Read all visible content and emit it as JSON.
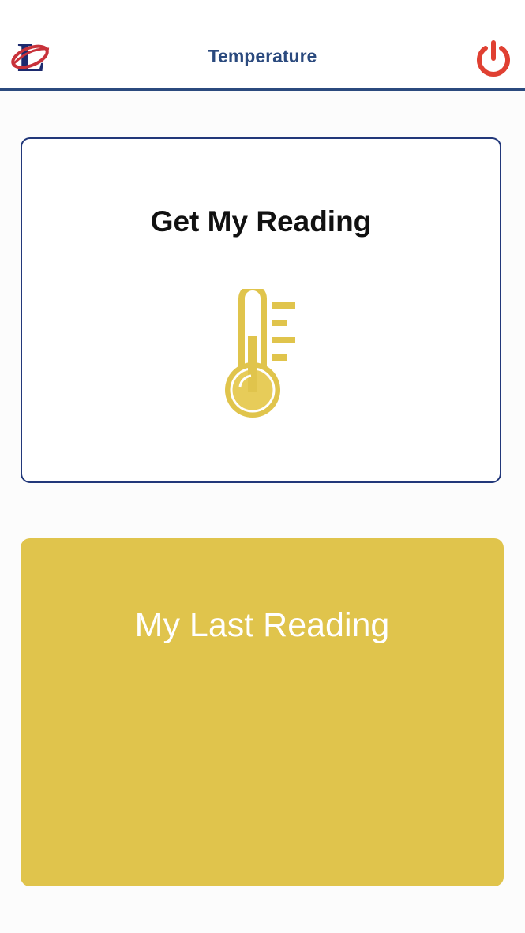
{
  "header": {
    "title": "Temperature",
    "logo_icon": "lamar-l-logo-icon",
    "power_icon": "power-icon"
  },
  "colors": {
    "brand_blue": "#2b4a7e",
    "border_blue": "#22387a",
    "gold": "#e0c44c",
    "power_red": "#e04032"
  },
  "cards": {
    "get_reading": {
      "label": "Get My Reading",
      "icon": "thermometer-icon"
    },
    "last_reading": {
      "label": "My Last Reading"
    }
  }
}
